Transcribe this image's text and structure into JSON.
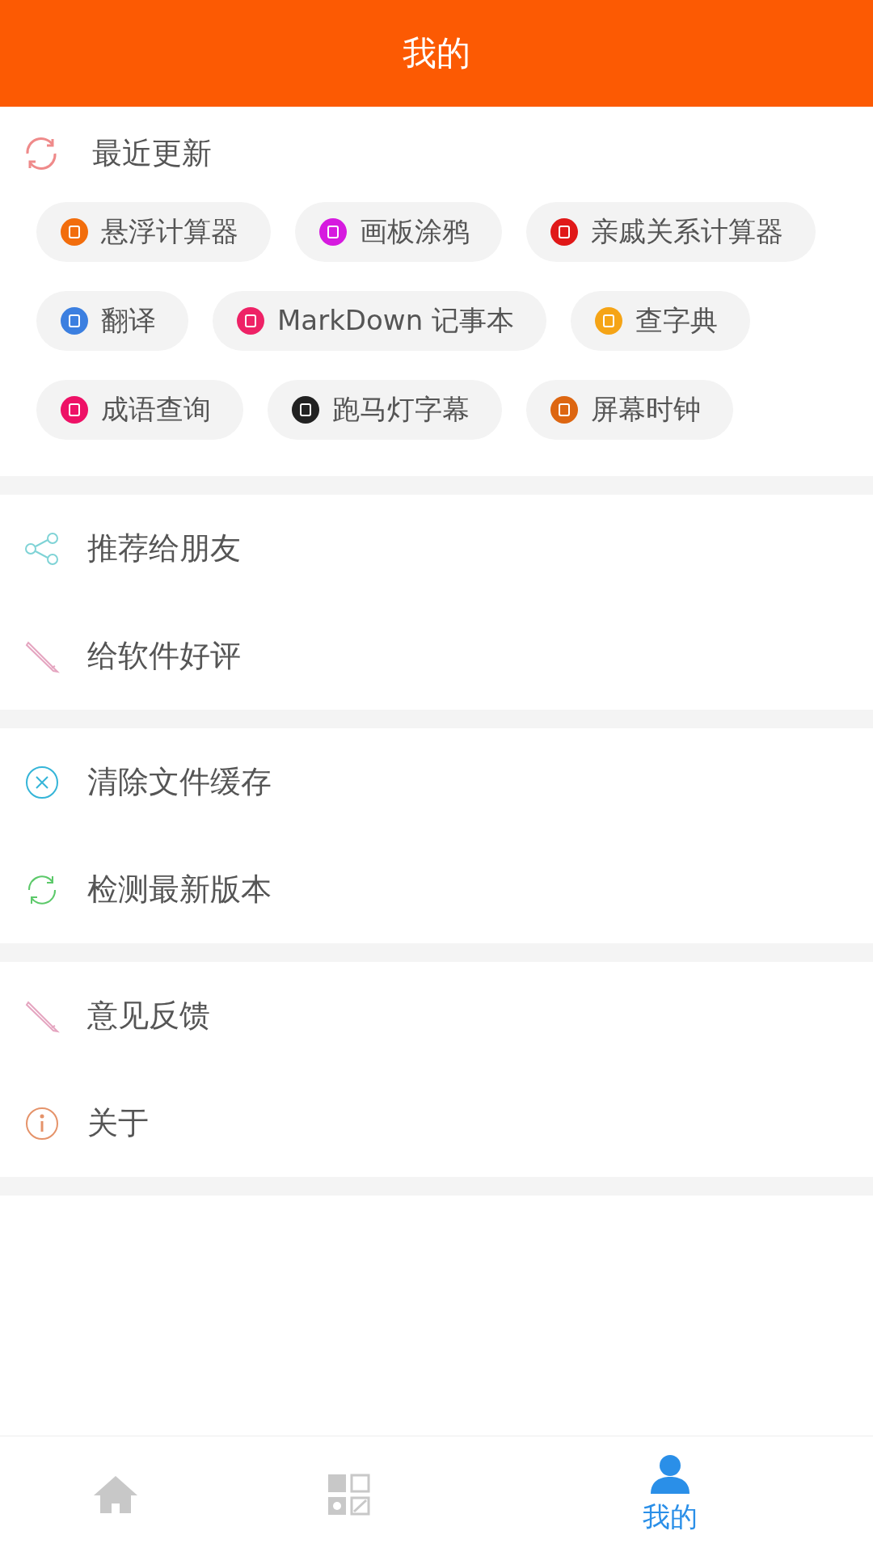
{
  "header": {
    "title": "我的"
  },
  "recent": {
    "title": "最近更新",
    "apps": [
      {
        "label": "悬浮计算器",
        "color": "#f26d0c"
      },
      {
        "label": "画板涂鸦",
        "color": "#d61adf"
      },
      {
        "label": "亲戚关系计算器",
        "color": "#e01818"
      },
      {
        "label": "翻译",
        "color": "#3b7fe0"
      },
      {
        "label": "MarkDown 记事本",
        "color": "#ee2266"
      },
      {
        "label": "查字典",
        "color": "#f5a416"
      },
      {
        "label": "成语查询",
        "color": "#ee1166"
      },
      {
        "label": "跑马灯字幕",
        "color": "#222222"
      },
      {
        "label": "屏幕时钟",
        "color": "#dd6611"
      }
    ]
  },
  "menu_groups": [
    [
      {
        "kind": "share",
        "label": "推荐给朋友"
      },
      {
        "kind": "pencil",
        "label": "给软件好评"
      }
    ],
    [
      {
        "kind": "clear",
        "label": "清除文件缓存"
      },
      {
        "kind": "refresh",
        "label": "检测最新版本"
      }
    ],
    [
      {
        "kind": "pencil",
        "label": "意见反馈"
      },
      {
        "kind": "info",
        "label": "关于"
      }
    ]
  ],
  "tab_bar": [
    {
      "kind": "home",
      "selected": false
    },
    {
      "kind": "grid",
      "selected": false
    },
    {
      "kind": "profile",
      "label": "我的",
      "selected": true
    }
  ]
}
